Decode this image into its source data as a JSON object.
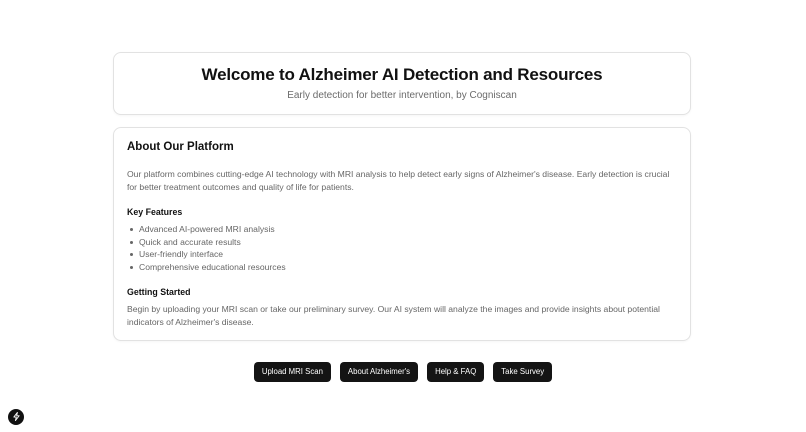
{
  "hero": {
    "title": "Welcome to Alzheimer AI Detection and Resources",
    "subtitle": "Early detection for better intervention, by Cogniscan"
  },
  "about": {
    "title": "About Our Platform",
    "intro": "Our platform combines cutting-edge AI technology with MRI analysis to help detect early signs of Alzheimer's disease. Early detection is crucial for better treatment outcomes and quality of life for patients.",
    "features_title": "Key Features",
    "features": [
      "Advanced AI-powered MRI analysis",
      "Quick and accurate results",
      "User-friendly interface",
      "Comprehensive educational resources"
    ],
    "getting_started_title": "Getting Started",
    "getting_started_text": "Begin by uploading your MRI scan or take our preliminary survey. Our AI system will analyze the images and provide insights about potential indicators of Alzheimer's disease."
  },
  "buttons": {
    "upload": "Upload MRI Scan",
    "about": "About Alzheimer's",
    "help": "Help & FAQ",
    "survey": "Take Survey"
  },
  "fab": {
    "icon": "lightning-icon"
  }
}
